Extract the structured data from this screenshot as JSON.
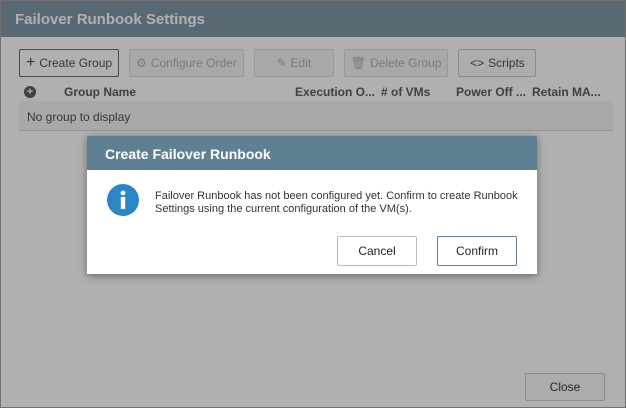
{
  "window": {
    "title": "Failover Runbook Settings"
  },
  "toolbar": {
    "create_group": "Create Group",
    "configure_order": "Configure Order",
    "edit": "Edit",
    "delete_group": "Delete Group",
    "scripts": "Scripts"
  },
  "grid": {
    "columns": [
      "Group Name",
      "Execution O...",
      "# of VMs",
      "Power Off ...",
      "Retain MA..."
    ],
    "empty_text": "No group to display"
  },
  "footer": {
    "close": "Close"
  },
  "dialog": {
    "title": "Create Failover Runbook",
    "message": "Failover Runbook has not been configured yet. Confirm to create Runbook Settings using the current configuration of the VM(s).",
    "cancel": "Cancel",
    "confirm": "Confirm"
  },
  "colors": {
    "header": "#5f7f92",
    "info": "#2a86c6"
  }
}
